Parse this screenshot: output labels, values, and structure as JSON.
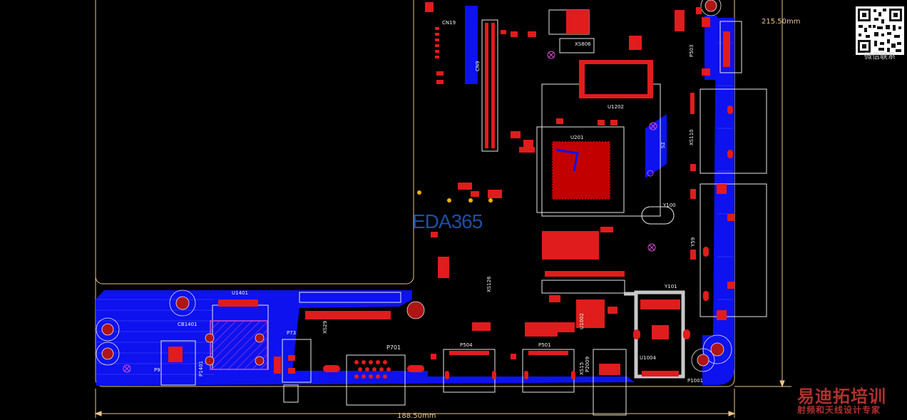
{
  "watermark": "EDA365",
  "qr_caption": "微信联系",
  "brand": {
    "line1": "易迪拓培训",
    "line2": "射频和天线设计专家"
  },
  "dimensions": {
    "height": "215.50mm",
    "width": "188.50mm"
  },
  "colors": {
    "copper_bottom": "#0d12ee",
    "pads": "#e11c1c",
    "silkscreen": "#f0f0f0",
    "outline": "#e8c58a",
    "watermark": "#1f56b4"
  },
  "designators": {
    "cn19": "CN19",
    "cn9": "CN9",
    "xs806": "XS806",
    "u1202": "U1202",
    "u201": "U201",
    "s2": "S2",
    "p503": "P503",
    "xs110": "XS110",
    "y100": "Y100",
    "y59": "Y59",
    "xs126": "XS126",
    "y101": "Y101",
    "u1401": "U1401",
    "cb1401": "CB1401",
    "p9": "P9",
    "p1401": "P1401",
    "p73": "P73",
    "p701": "P701",
    "xs29": "XS29",
    "p504": "P504",
    "p501": "P501",
    "u1002": "U1002",
    "xs15": "XS15",
    "p2009": "P2009",
    "u1004": "U1004",
    "p1001": "P1001"
  }
}
